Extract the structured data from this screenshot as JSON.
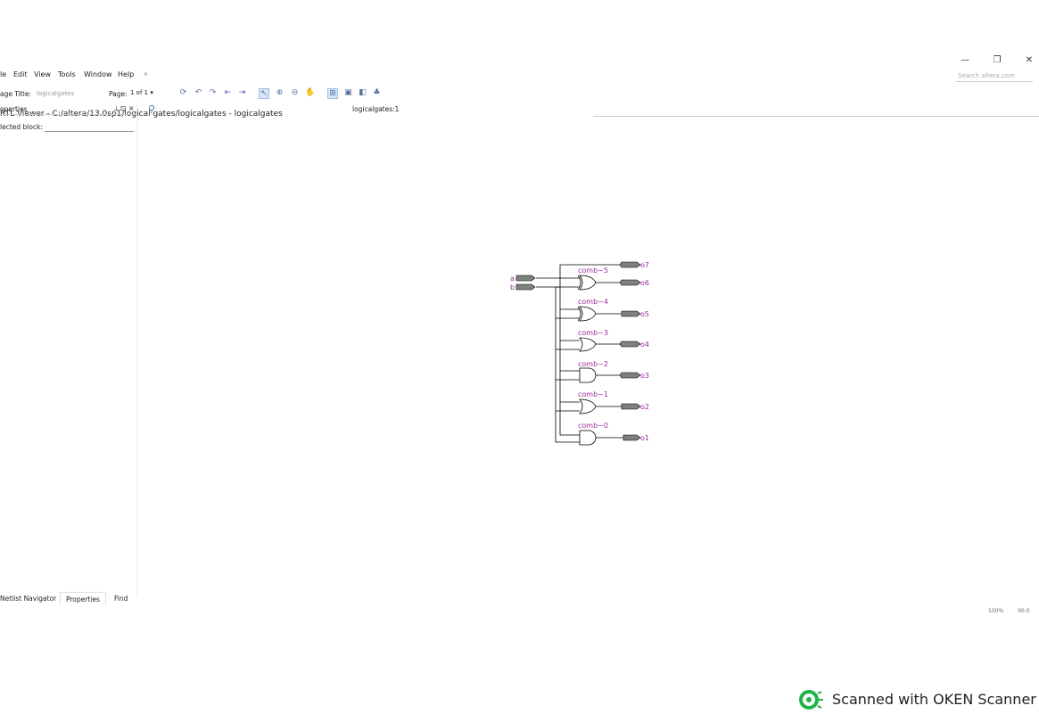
{
  "window": {
    "title": "RTL Viewer - C:/altera/13.0sp1/logical gates/logicalgates - logicalgates",
    "buttons": [
      "—",
      "❐",
      "✕"
    ]
  },
  "menu": {
    "items": [
      "le",
      "Edit",
      "View",
      "Tools",
      "Window",
      "Help"
    ],
    "search_placeholder": "Search altera.com"
  },
  "toolbar": {
    "page_title_label": "age Title:",
    "page_title_value": "logicalgates",
    "page_label": "Page:",
    "page_value": "1 of 1"
  },
  "properties_panel": {
    "title": "operties",
    "controls": [
      "⊥",
      "⊡",
      "×"
    ],
    "selected_block_label": "lected block:",
    "tabs": [
      "Netlist Navigator",
      "Properties",
      "Find"
    ],
    "active_tab": "Properties"
  },
  "canvas": {
    "title": "logicalgates:1",
    "inputs": [
      "a",
      "b"
    ],
    "gates": [
      {
        "name": "comb~5",
        "type": "xor",
        "output": "o6"
      },
      {
        "name": "comb~4",
        "type": "xnor",
        "output": "o5"
      },
      {
        "name": "comb~3",
        "type": "or",
        "output": "o4"
      },
      {
        "name": "comb~2",
        "type": "and",
        "output": "o3"
      },
      {
        "name": "comb~1",
        "type": "nor",
        "output": "o2"
      },
      {
        "name": "comb~0",
        "type": "nand",
        "output": "o1"
      }
    ],
    "extra_output": "o7",
    "zoom": "100%",
    "coords": "00:0"
  },
  "overlay": {
    "scanner_text": "Scanned with OKEN Scanner"
  },
  "colors": {
    "label": "#9c2aa0",
    "wire": "#000000",
    "pin_fill": "#808080"
  }
}
